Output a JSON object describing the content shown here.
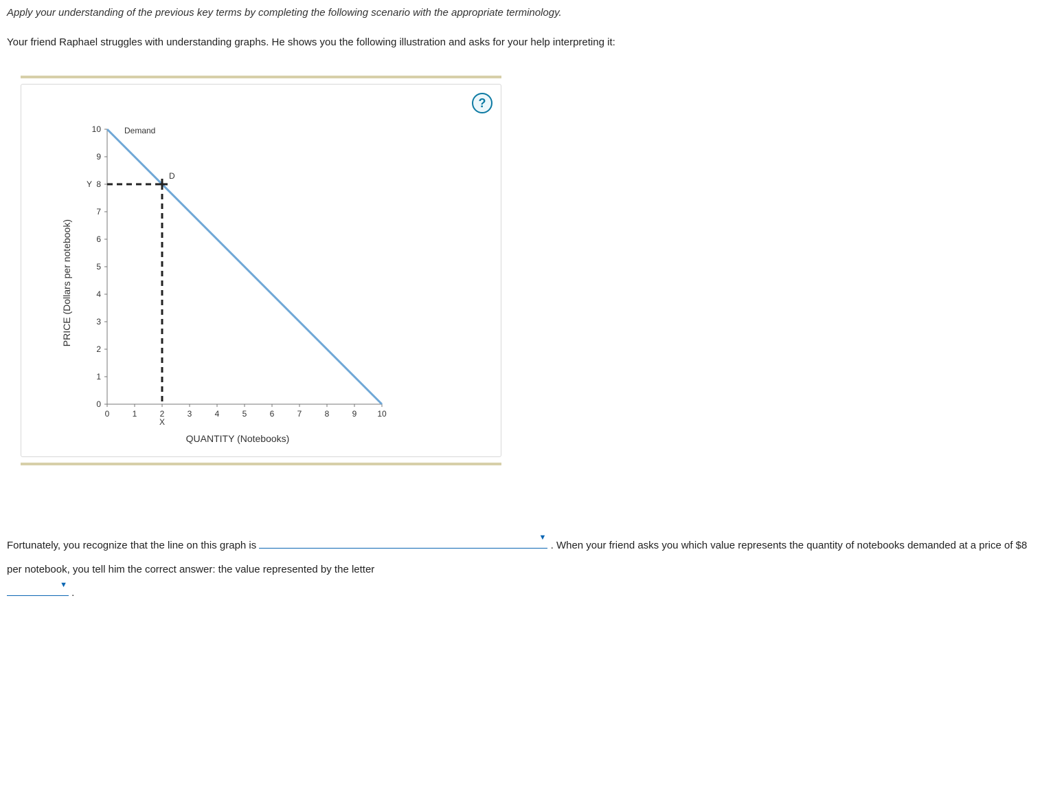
{
  "instruction": "Apply your understanding of the previous key terms by completing the following scenario with the appropriate terminology.",
  "scenario": "Your friend Raphael struggles with understanding graphs. He shows you the following illustration and asks for your help interpreting it:",
  "help_glyph": "?",
  "chart_data": {
    "type": "line",
    "title": "",
    "xlabel": "QUANTITY (Notebooks)",
    "ylabel": "PRICE (Dollars per notebook)",
    "xlim": [
      0,
      10
    ],
    "ylim": [
      0,
      10
    ],
    "x_ticks": [
      "0",
      "1",
      "2",
      "3",
      "4",
      "5",
      "6",
      "7",
      "8",
      "9",
      "10"
    ],
    "y_ticks": [
      "0",
      "1",
      "2",
      "3",
      "4",
      "5",
      "6",
      "7",
      "8",
      "9",
      "10"
    ],
    "series": [
      {
        "name": "Demand",
        "x": [
          0,
          10
        ],
        "y": [
          10,
          0
        ]
      }
    ],
    "annotations": {
      "demand_label": "Demand",
      "point_D_label": "D",
      "point_D": {
        "x": 2,
        "y": 8
      },
      "Y_label": "Y",
      "Y_at_price": 8,
      "X_label": "X",
      "X_at_quantity": 2
    }
  },
  "completion": {
    "part1": "Fortunately, you recognize that the line on this graph is ",
    "dropdown1_value": "",
    "part2": " . When your friend asks you which value represents the quantity of notebooks demanded at a price of $8 per notebook, you tell him the correct answer: the value represented by the letter ",
    "dropdown2_value": "",
    "part3": " ."
  },
  "caret_glyph": "▼"
}
